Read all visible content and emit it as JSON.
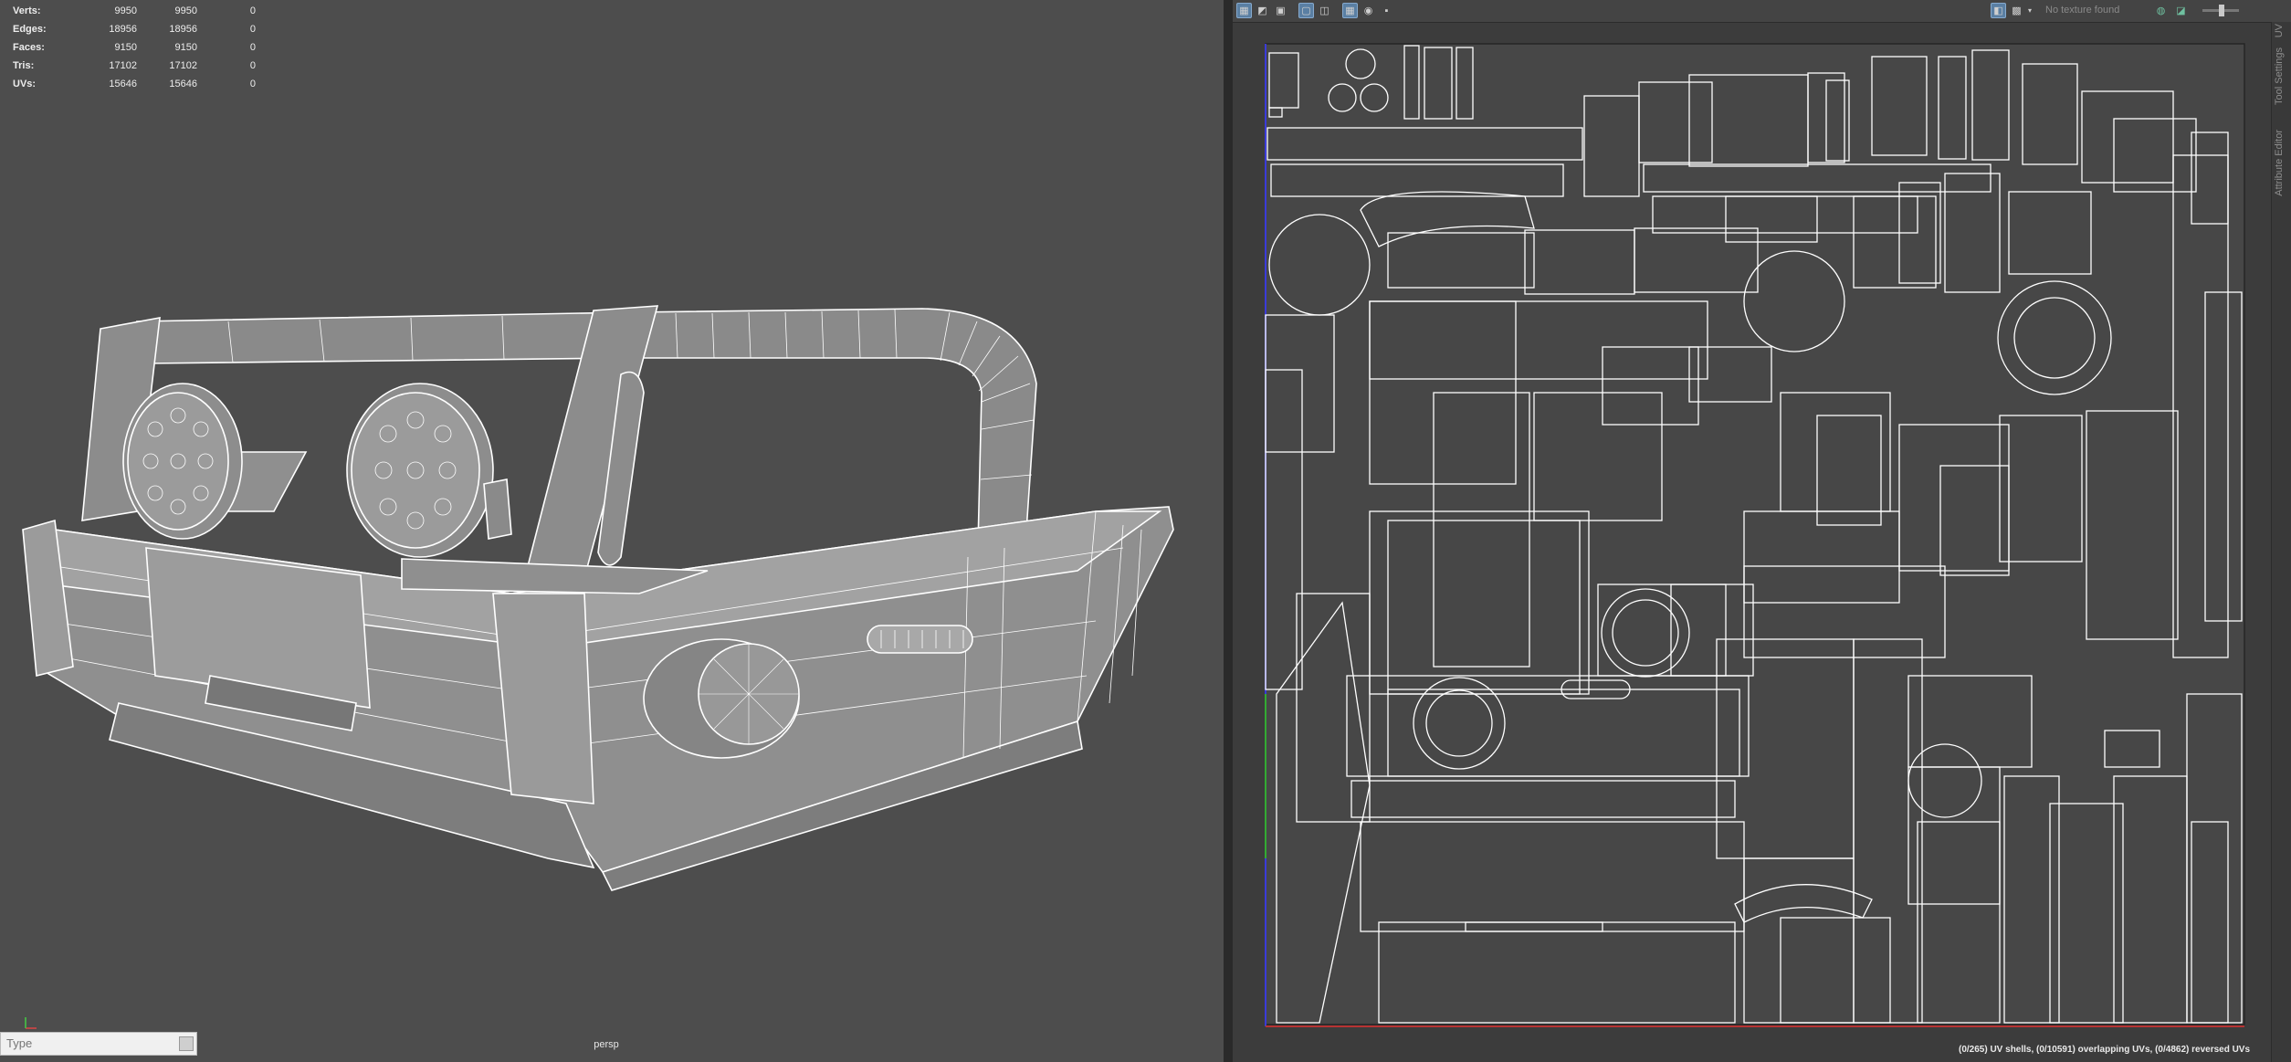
{
  "viewport": {
    "stats": [
      {
        "label": "Verts:",
        "values": [
          "9950",
          "9950",
          "0"
        ]
      },
      {
        "label": "Edges:",
        "values": [
          "18956",
          "18956",
          "0"
        ]
      },
      {
        "label": "Faces:",
        "values": [
          "9150",
          "9150",
          "0"
        ]
      },
      {
        "label": "Tris:",
        "values": [
          "17102",
          "17102",
          "0"
        ]
      },
      {
        "label": "UVs:",
        "values": [
          "15646",
          "15646",
          "0"
        ]
      }
    ],
    "camera_name": "persp",
    "background": "#4d4d4d",
    "wire_color": "#ffffff"
  },
  "command_line": {
    "placeholder": "Type"
  },
  "uv_editor": {
    "texture_label": "No texture found",
    "status": "(0/265) UV shells, (0/10591) overlapping UVs, (0/4862) reversed UVs",
    "side_tabs": [
      "UV",
      "Tool Settings",
      "Attribute Editor"
    ],
    "toolbar_icons": [
      "uv-grid-icon",
      "uv-distort-icon",
      "uv-image-icon",
      "uv-frame-icon",
      "uv-split-icon",
      "uv-checker-icon",
      "uv-snapshot-icon",
      "uv-camera-icon",
      "uv-texture-toggle-icon",
      "uv-checkerboard-icon",
      "uv-image-display-icon",
      "uv-filter-icon"
    ]
  }
}
